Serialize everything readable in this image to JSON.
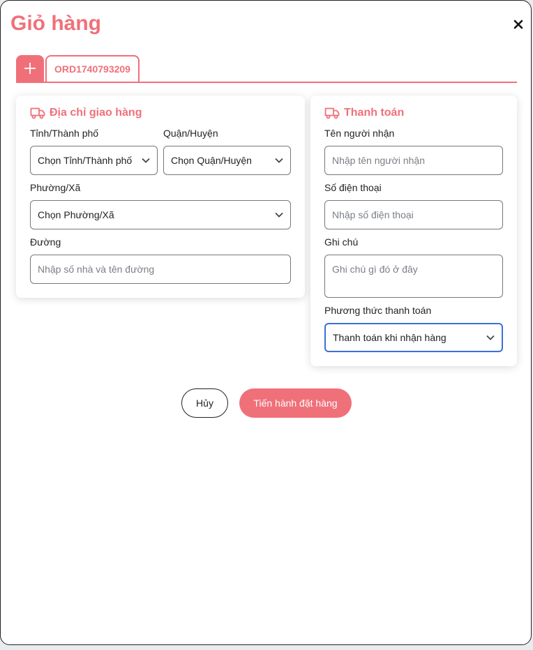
{
  "header": {
    "title": "Giỏ hàng"
  },
  "tabs": {
    "order_label": "ORD1740793209"
  },
  "shipping": {
    "title": "Địa chỉ giao hàng",
    "province_label": "Tỉnh/Thành phố",
    "province_value": "Chọn Tỉnh/Thành phố",
    "district_label": "Quận/Huyện",
    "district_value": "Chọn Quận/Huyện",
    "ward_label": "Phường/Xã",
    "ward_value": "Chọn Phường/Xã",
    "street_label": "Đường",
    "street_placeholder": "Nhập số nhà và tên đường"
  },
  "payment": {
    "title": "Thanh toán",
    "recipient_label": "Tên người nhận",
    "recipient_placeholder": "Nhập tên người nhận",
    "phone_label": "Số điện thoại",
    "phone_placeholder": "Nhập số điện thoại",
    "note_label": "Ghi chú",
    "note_placeholder": "Ghi chú gì đó ở đây",
    "method_label": "Phương thức thanh toán",
    "method_value": "Thanh toán khi nhận hàng"
  },
  "actions": {
    "cancel": "Hủy",
    "submit": "Tiến hành đặt hàng"
  },
  "colors": {
    "accent": "#f0707a",
    "focus": "#3a6fd8"
  },
  "icons": {
    "close": "close-icon",
    "add": "plus-icon",
    "truck": "truck-icon",
    "chevron": "chevron-down-icon"
  }
}
